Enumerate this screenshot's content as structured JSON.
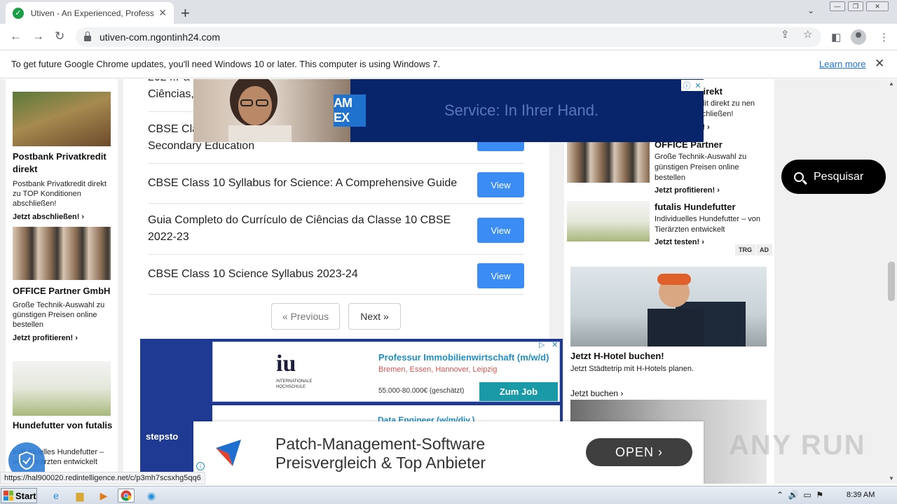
{
  "browser": {
    "tab_title": "Utiven - An Experienced, Profession",
    "tab_close": "✕",
    "new_tab": "+",
    "url": "utiven-com.ngontinh24.com"
  },
  "infobar": {
    "message": "To get future Google Chrome updates, you'll need Windows 10 or later. This computer is using Windows 7.",
    "learn_more": "Learn more",
    "close": "✕"
  },
  "left_ads": [
    {
      "title": "Postbank Privatkredit direkt",
      "desc": "Postbank Privatkredit direkt zu TOP Konditionen abschließen!",
      "cta": "Jetzt abschließen! ›"
    },
    {
      "title": "OFFICE Partner GmbH",
      "desc": "Große Technik-Auswahl zu günstigen Preisen online bestellen",
      "cta": "Jetzt profitieren! ›"
    },
    {
      "title": "Hundefutter von futalis",
      "desc": "Individuelles Hundefutter – von Tierärzten entwickelt",
      "cta": ""
    }
  ],
  "main": {
    "partial_row_line1": "2024.Pa",
    "partial_row_line2": "Ciências,",
    "rows": [
      {
        "text": "CBSE Cla… Secondary Education",
        "line1": "CBSE Cla",
        "line2": "Secondary Education",
        "button": "View"
      },
      {
        "text": "CBSE Class 10 Syllabus for Science: A Comprehensive Guide",
        "button": "View"
      },
      {
        "text": "Guia Completo do Currículo de Ciências da Classe 10 CBSE 2022-23",
        "button": "View"
      },
      {
        "text": "CBSE Class 10 Science Syllabus 2023-24",
        "button": "View"
      }
    ],
    "prev": "« Previous",
    "next": "Next »"
  },
  "stepstone_ad": {
    "logo": "iu",
    "logo_sub": "INTERNATIONALE HOCHSCHULE",
    "job_title": "Professur Immobilienwirtschaft (m/w/d)",
    "locations": "Bremen, Essen, Hannover, Leipzig",
    "salary": "55.000-80.000€ (geschätzt)",
    "cta": "Zum Job",
    "job2": "Data Engineer (w/m/div.)",
    "brand": "stepsto"
  },
  "right_ads": [
    {
      "title": "it direkt",
      "desc": "kredit direkt zu nen abschließen!",
      "cta": "zen! ›"
    },
    {
      "title": "OFFICE Partner",
      "desc": "Große Technik-Auswahl zu günstigen Preisen online bestellen",
      "cta": "Jetzt profitieren! ›"
    },
    {
      "title": "futalis Hundefutter",
      "desc": "Individuelles Hundefutter – von Tierärzten entwickelt",
      "cta": "Jetzt testen! ›"
    }
  ],
  "tags": [
    "TRG",
    "AD"
  ],
  "hotel_ad": {
    "title": "Jetzt H-Hotel buchen!",
    "desc": "Jetzt Städtetrip mit H-Hotels planen.",
    "cta": "Jetzt buchen ›"
  },
  "amex_ad": {
    "logo": "AM EX",
    "text": "Service: In Ihrer Hand."
  },
  "anchor_ad": {
    "line1": "Patch-Management-Software",
    "line2": "Preisvergleich & Top Anbieter",
    "button": "OPEN ›"
  },
  "search_pill": "Pesquisar",
  "watermark": "ANY RUN",
  "status_url": "https://hal900020.redintelligence.net/c/p3mh7scsxhg5qq6",
  "taskbar": {
    "start": "Start",
    "clock": "8:39 AM"
  }
}
